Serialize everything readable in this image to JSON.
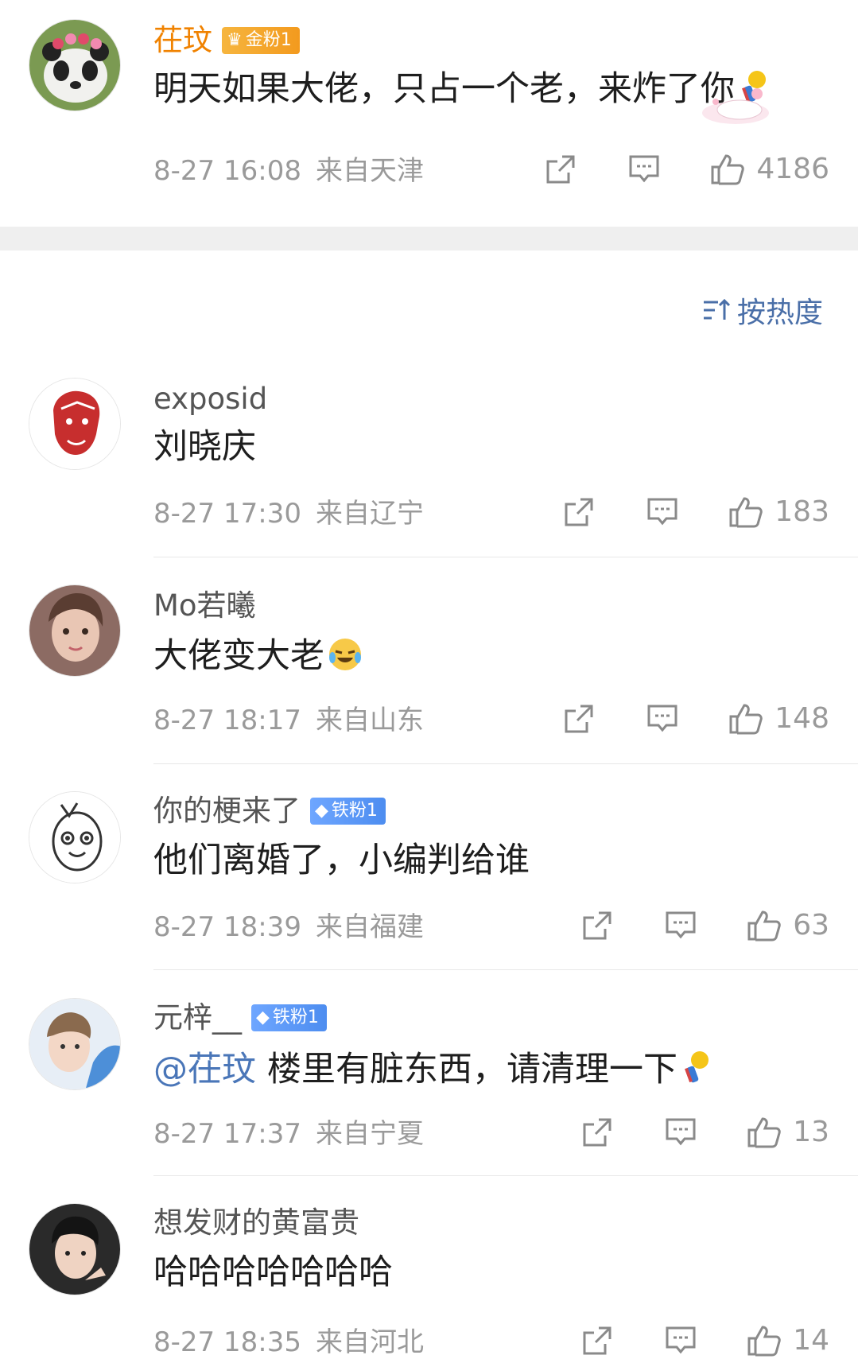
{
  "sort": {
    "label": "按热度"
  },
  "comments": [
    {
      "username": "茌玟",
      "badge": "金粉1",
      "text": "明天如果大佬，只占一个老，来炸了你",
      "time": "8-27 16:08",
      "location": "来自天津",
      "likes": "4186"
    },
    {
      "username": "exposid",
      "text": "刘晓庆",
      "time": "8-27 17:30",
      "location": "来自辽宁",
      "likes": "183"
    },
    {
      "username": "Mo若曦",
      "text": "大佬变大老",
      "time": "8-27 18:17",
      "location": "来自山东",
      "likes": "148"
    },
    {
      "username": "你的梗来了",
      "badge": "铁粉1",
      "text": "他们离婚了，小编判给谁",
      "time": "8-27 18:39",
      "location": "来自福建",
      "likes": "63"
    },
    {
      "username": "元梓__",
      "badge": "铁粉1",
      "mention": "@茌玟",
      "text": "楼里有脏东西，请清理一下",
      "time": "8-27 17:37",
      "location": "来自宁夏",
      "likes": "13"
    },
    {
      "username": "想发财的黄富贵",
      "text": "哈哈哈哈哈哈哈",
      "time": "8-27 18:35",
      "location": "来自河北",
      "likes": "14"
    }
  ],
  "colors": {
    "accent_gold": "#f08200",
    "mention_blue": "#4a76b8",
    "meta_gray": "#9a9a9a"
  }
}
